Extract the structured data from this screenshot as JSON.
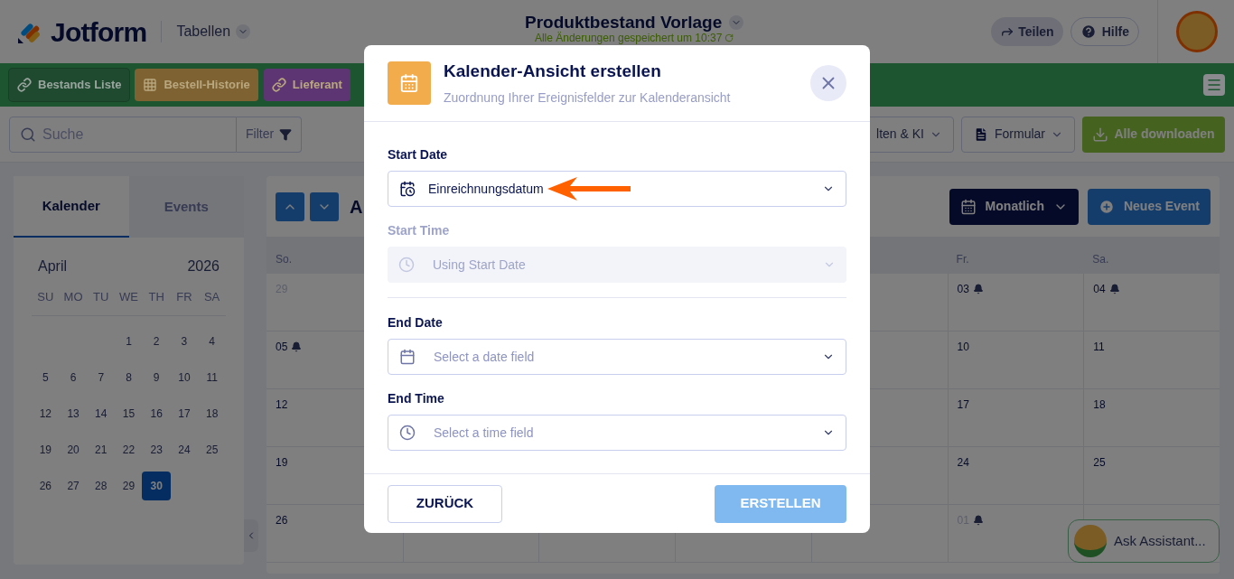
{
  "header": {
    "brand": "Jotform",
    "section_menu": "Tabellen",
    "title": "Produktbestand Vorlage",
    "saved_status": "Alle Änderungen gespeichert um 10:37",
    "share_button": "Teilen",
    "help_button": "Hilfe"
  },
  "table_tabs": [
    {
      "label": "Bestands Liste",
      "kind": "link",
      "color": "#1f4a30",
      "selected": true
    },
    {
      "label": "Bestell-Historie",
      "kind": "table",
      "color": "#7f6231",
      "selected": false
    },
    {
      "label": "Lieferant",
      "kind": "link",
      "color": "#5e3573",
      "selected": false
    }
  ],
  "toolbar": {
    "search_placeholder": "Suche",
    "filter_button": "Filter",
    "buttons": [
      {
        "label": "lten & KI",
        "kind": "menu"
      },
      {
        "label": "Formular",
        "kind": "form"
      },
      {
        "label": "Alle downloaden",
        "kind": "download"
      }
    ]
  },
  "sidebar": {
    "tabs": [
      {
        "label": "Kalender",
        "selected": true
      },
      {
        "label": "Events",
        "selected": false
      }
    ],
    "mini_calendar": {
      "month": "April",
      "year": "2026",
      "weekdays": [
        "SU",
        "MO",
        "TU",
        "WE",
        "TH",
        "FR",
        "SA"
      ],
      "weeks": [
        [
          {
            "kind": "blank"
          },
          {
            "kind": "blank"
          },
          {
            "kind": "blank"
          },
          {
            "kind": "day",
            "day": "1",
            "selected": false
          },
          {
            "kind": "day",
            "day": "2",
            "selected": false
          },
          {
            "kind": "day",
            "day": "3",
            "selected": false
          },
          {
            "kind": "day",
            "day": "4",
            "selected": false
          }
        ],
        [
          {
            "kind": "day",
            "day": "5",
            "selected": false
          },
          {
            "kind": "day",
            "day": "6",
            "selected": false
          },
          {
            "kind": "day",
            "day": "7",
            "selected": false
          },
          {
            "kind": "day",
            "day": "8",
            "selected": false
          },
          {
            "kind": "day",
            "day": "9",
            "selected": false
          },
          {
            "kind": "day",
            "day": "10",
            "selected": false
          },
          {
            "kind": "day",
            "day": "11",
            "selected": false
          }
        ],
        [
          {
            "kind": "day",
            "day": "12",
            "selected": false
          },
          {
            "kind": "day",
            "day": "13",
            "selected": false
          },
          {
            "kind": "day",
            "day": "14",
            "selected": false
          },
          {
            "kind": "day",
            "day": "15",
            "selected": false
          },
          {
            "kind": "day",
            "day": "16",
            "selected": false
          },
          {
            "kind": "day",
            "day": "17",
            "selected": false
          },
          {
            "kind": "day",
            "day": "18",
            "selected": false
          }
        ],
        [
          {
            "kind": "day",
            "day": "19",
            "selected": false
          },
          {
            "kind": "day",
            "day": "20",
            "selected": false
          },
          {
            "kind": "day",
            "day": "21",
            "selected": false
          },
          {
            "kind": "day",
            "day": "22",
            "selected": false
          },
          {
            "kind": "day",
            "day": "23",
            "selected": false
          },
          {
            "kind": "day",
            "day": "24",
            "selected": false
          },
          {
            "kind": "day",
            "day": "25",
            "selected": false
          }
        ],
        [
          {
            "kind": "day",
            "day": "26",
            "selected": false
          },
          {
            "kind": "day",
            "day": "27",
            "selected": false
          },
          {
            "kind": "day",
            "day": "28",
            "selected": false
          },
          {
            "kind": "day",
            "day": "29",
            "selected": false
          },
          {
            "kind": "day",
            "day": "30",
            "selected": true
          },
          {
            "kind": "blank"
          },
          {
            "kind": "blank"
          }
        ]
      ]
    }
  },
  "calendar": {
    "title": "A",
    "view_button": "Monatlich",
    "new_button": "Neues Event",
    "weekdays": [
      {
        "kind": "label",
        "label": "So."
      },
      {
        "kind": "covered"
      },
      {
        "kind": "covered"
      },
      {
        "kind": "covered"
      },
      {
        "kind": "covered"
      },
      {
        "kind": "label",
        "label": "Fr."
      },
      {
        "kind": "label",
        "label": "Sa."
      }
    ],
    "weeks": [
      [
        {
          "kind": "day",
          "day": "29",
          "other_month": true,
          "bell": false
        },
        {
          "kind": "covered"
        },
        {
          "kind": "covered"
        },
        {
          "kind": "covered"
        },
        {
          "kind": "covered"
        },
        {
          "kind": "day",
          "day": "03",
          "other_month": false,
          "bell": true
        },
        {
          "kind": "day",
          "day": "04",
          "other_month": false,
          "bell": true
        }
      ],
      [
        {
          "kind": "day",
          "day": "05",
          "other_month": false,
          "bell": true
        },
        {
          "kind": "covered"
        },
        {
          "kind": "covered"
        },
        {
          "kind": "covered"
        },
        {
          "kind": "covered"
        },
        {
          "kind": "day",
          "day": "10",
          "other_month": false,
          "bell": false
        },
        {
          "kind": "day",
          "day": "11",
          "other_month": false,
          "bell": false
        }
      ],
      [
        {
          "kind": "day",
          "day": "12",
          "other_month": false,
          "bell": false
        },
        {
          "kind": "covered"
        },
        {
          "kind": "covered"
        },
        {
          "kind": "covered"
        },
        {
          "kind": "covered"
        },
        {
          "kind": "day",
          "day": "17",
          "other_month": false,
          "bell": false
        },
        {
          "kind": "day",
          "day": "18",
          "other_month": false,
          "bell": false
        }
      ],
      [
        {
          "kind": "day",
          "day": "19",
          "other_month": false,
          "bell": false
        },
        {
          "kind": "covered"
        },
        {
          "kind": "covered"
        },
        {
          "kind": "covered"
        },
        {
          "kind": "covered"
        },
        {
          "kind": "day",
          "day": "24",
          "other_month": false,
          "bell": false
        },
        {
          "kind": "day",
          "day": "25",
          "other_month": false,
          "bell": false
        }
      ],
      [
        {
          "kind": "day",
          "day": "26",
          "other_month": false,
          "bell": false
        },
        {
          "kind": "covered"
        },
        {
          "kind": "covered"
        },
        {
          "kind": "covered"
        },
        {
          "kind": "covered"
        },
        {
          "kind": "day",
          "day": "01",
          "other_month": true,
          "bell": true
        },
        {
          "kind": "covered"
        }
      ]
    ]
  },
  "assistant": {
    "label": "Ask Assistant..."
  },
  "dialog": {
    "title": "Kalender-Ansicht erstellen",
    "subtitle": "Zuordnung Ihrer Ereignisfelder zur Kalenderansicht",
    "sections": [
      [
        {
          "label": "Start Date",
          "kind": "datetime",
          "value": "Einreichnungsdatum",
          "disabled": false,
          "annotated": true
        },
        {
          "label": "Start Time",
          "kind": "time",
          "placeholder": "Using Start Date",
          "disabled": true,
          "annotated": false
        }
      ],
      [
        {
          "label": "End Date",
          "kind": "date",
          "placeholder": "Select a date field",
          "disabled": false,
          "annotated": false
        },
        {
          "label": "End Time",
          "kind": "time",
          "placeholder": "Select a time field",
          "disabled": false,
          "annotated": false
        }
      ]
    ],
    "back_button": {
      "label": "ZURÜCK",
      "disabled": false
    },
    "create_button": {
      "label": "ERSTELLEN",
      "disabled": true
    }
  }
}
